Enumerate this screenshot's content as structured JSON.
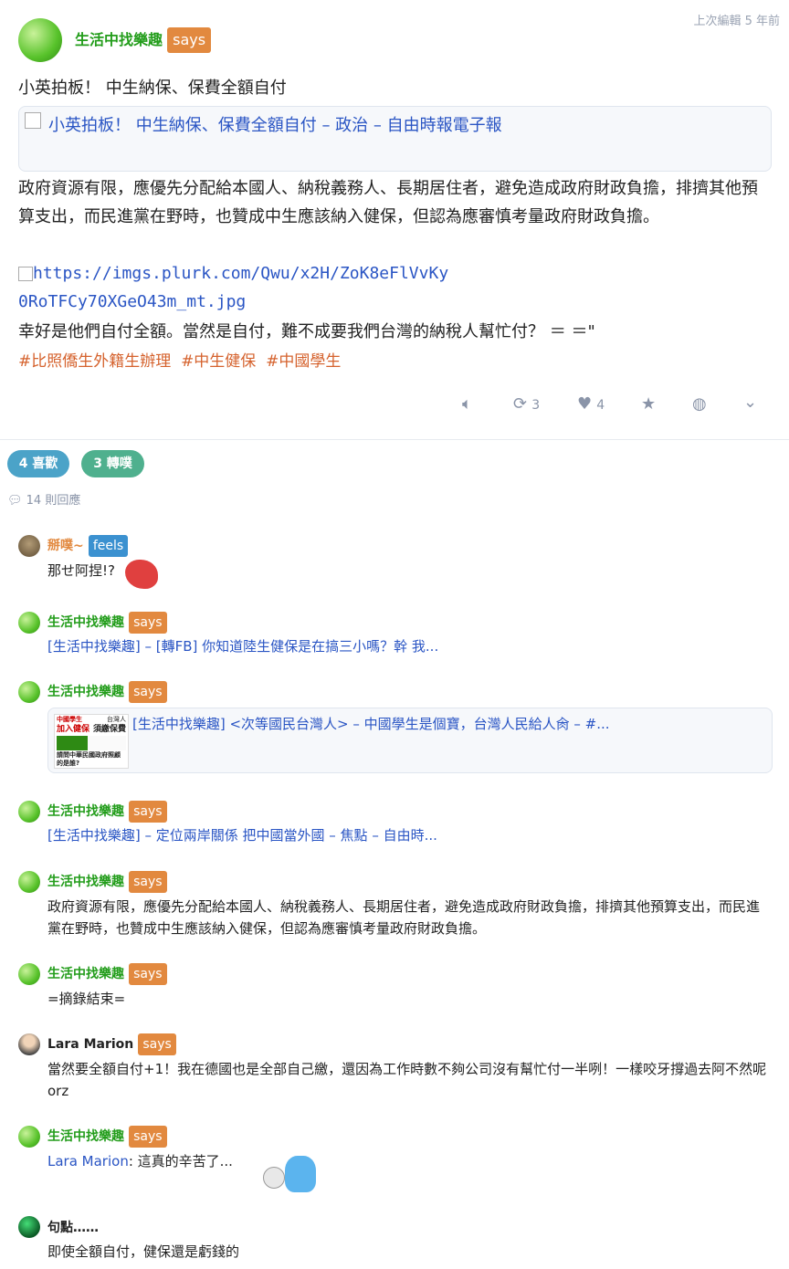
{
  "post": {
    "author": "生活中找樂趣",
    "qualifier": "says",
    "edited": "上次編輯 5 年前",
    "title": "小英拍板！ 中生納保、保費全額自付",
    "link_card_text": "小英拍板！ 中生納保、保費全額自付 – 政治 – 自由時報電子報",
    "body": "政府資源有限，應優先分配給本國人、納稅義務人、長期居住者，避免造成政府財政負擔，排擠其他預算支出，而民進黨在野時，也贊成中生應該納入健保，但認為應審慎考量政府財政負擔。",
    "image_link_1": "https://imgs.plurk.com/Qwu/x2H/ZoK8eFlVvKy",
    "image_link_2": "0RoTFCy70XGeO43m_mt.jpg",
    "closing": "幸好是他們自付全額。當然是自付，難不成要我們台灣的納稅人幫忙付？ ＝ ＝\"",
    "tags": [
      "#比照僑生外籍生辦理",
      "#中生健保",
      "#中國學生"
    ]
  },
  "actions": {
    "mute_icon": "speaker-icon",
    "replurk_count": "3",
    "like_count": "4"
  },
  "stats": {
    "likes": "4 喜歡",
    "replurks": "3 轉噗",
    "responses": "14 則回應"
  },
  "responses": [
    {
      "author": "掰噗~",
      "qualifier": "feels",
      "text": "那せ阿捏!?"
    },
    {
      "author": "生活中找樂趣",
      "qualifier": "says",
      "text": "[生活中找樂趣] – [轉FB] 你知道陸生健保是在搞三小嗎？幹 我..."
    },
    {
      "author": "生活中找樂趣",
      "qualifier": "says",
      "text": "[生活中找樂趣] <次等國民台灣人> – 中國學生是個寶，台灣人民給人肏 – #..."
    },
    {
      "author": "生活中找樂趣",
      "qualifier": "says",
      "text": "[生活中找樂趣] – 定位兩岸關係 把中國當外國 – 焦點 – 自由時..."
    },
    {
      "author": "生活中找樂趣",
      "qualifier": "says",
      "text": "政府資源有限，應優先分配給本國人、納稅義務人、長期居住者，避免造成政府財政負擔，排擠其他預算支出，而民進黨在野時，也贊成中生應該納入健保，但認為應審慎考量政府財政負擔。"
    },
    {
      "author": "生活中找樂趣",
      "qualifier": "says",
      "text": "=摘錄結束="
    },
    {
      "author": "Lara Marion",
      "qualifier": "says",
      "text": "當然要全額自付+1！我在德國也是全部自己繳，還因為工作時數不夠公司沒有幫忙付一半咧！一樣咬牙撐過去阿不然呢 orz"
    },
    {
      "author": "生活中找樂趣",
      "qualifier": "says",
      "mention": "Lara Marion",
      "text": ": 這真的辛苦了..."
    },
    {
      "author": "句點……",
      "qualifier": "",
      "text": "即使全額自付，健保還是虧錢的"
    }
  ],
  "thumb": {
    "l1": "中國學生",
    "l2": "台灣人",
    "l3": "加入健保",
    "l4": "須繳保費",
    "l5": "請問中華民國政府照顧的是誰?"
  }
}
